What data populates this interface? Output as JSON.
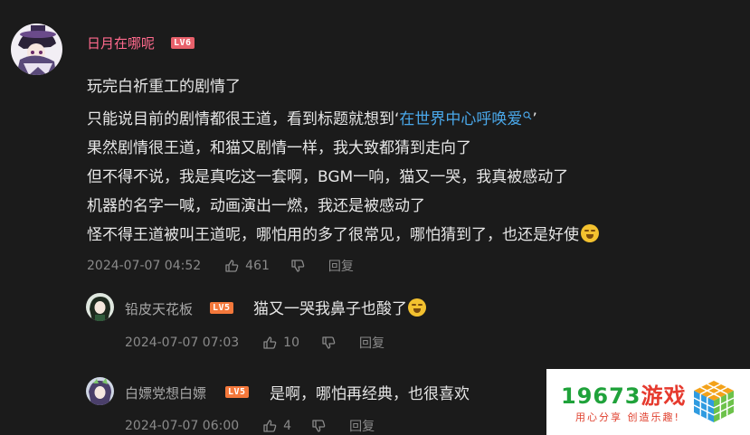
{
  "comment": {
    "username": "日月在哪呢",
    "level": "LV6",
    "lines": [
      "玩完白祈重工的剧情了",
      "只能说目前的剧情都很王道，看到标题就想到",
      "果然剧情很王道，和猫又剧情一样，我大致都猜到走向了",
      "但不得不说，我是真吃这一套啊，BGM一响，猫又一哭，我真被感动了",
      "机器的名字一喊，动画演出一燃，我还是被感动了",
      "怪不得王道被叫王道呢，哪怕用的多了很常见，哪怕猜到了，也还是好使"
    ],
    "quote_open": "‘",
    "link_text": "在世界中心呼唤爱",
    "quote_close": "’",
    "timestamp": "2024-07-07 04:52",
    "likes": "461",
    "reply_label": "回复"
  },
  "replies": [
    {
      "username": "铅皮天花板",
      "level": "LV5",
      "text": "猫又一哭我鼻子也酸了",
      "timestamp": "2024-07-07 07:03",
      "likes": "10",
      "reply_label": "回复"
    },
    {
      "username": "白嫖党想白嫖",
      "level": "LV5",
      "text": "是啊，哪怕再经典，也很喜欢",
      "timestamp": "2024-07-07 06:00",
      "likes": "4",
      "reply_label": "回复"
    }
  ],
  "watermark": {
    "title_number": "19673",
    "title_text": "游戏",
    "slogan": "用心分享 创造乐趣!"
  },
  "colors": {
    "background": "#1b1b1b",
    "main_username": "#ff6a8d",
    "reply_username": "#a9a9a9",
    "link": "#4aa8ea",
    "meta": "#8a8a8a"
  },
  "icons": [
    "thumb-up-icon",
    "thumb-down-icon",
    "search-icon",
    "grin-emoji-icon",
    "laughing-tears-emoji-icon"
  ]
}
